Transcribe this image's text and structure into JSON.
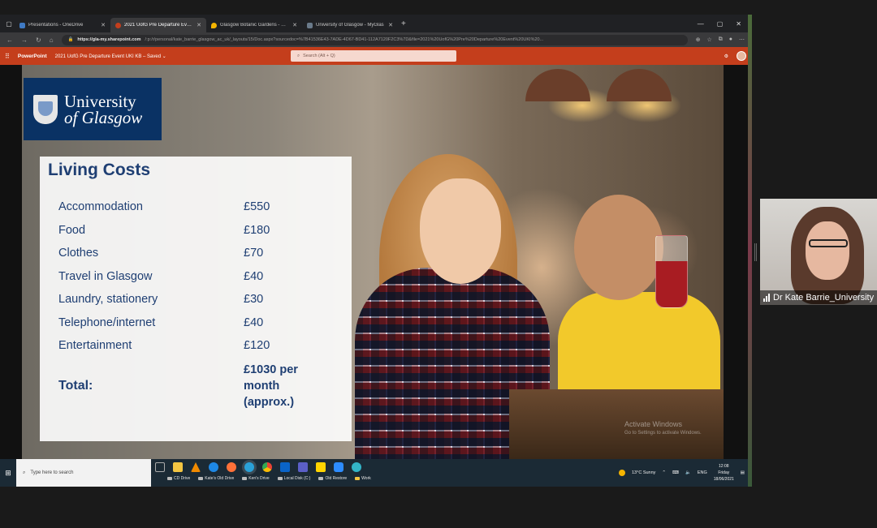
{
  "browser": {
    "tabs": [
      {
        "title": "Presentations - OneDrive",
        "color": "#3f7ac4",
        "active": false
      },
      {
        "title": "2021 UofG Pre Departure Event",
        "color": "#c43e1c",
        "active": true
      },
      {
        "title": "Glasgow Botanic Gardens - Goo",
        "color": "#f4b400",
        "active": false
      },
      {
        "title": "University of Glasgow - MyGlas",
        "color": "#6a7a8a",
        "active": false
      }
    ],
    "new_tab": "+",
    "url_host": "https://gla-my.sharepoint.com",
    "url_path": "/:p:/r/personal/kate_barrie_glasgow_ac_uk/_layouts/15/Doc.aspx?sourcedoc=%7B41536E43-7ADE-4D67-BD41-112A7120F2C3%7D&file=2021%20UofG%20Pre%20Departure%20Event%20UKI%20..."
  },
  "powerpoint": {
    "app_name": "PowerPoint",
    "doc_title": "2021 UofG Pre Departure Event UKI KB",
    "saved_status": "Saved",
    "search_placeholder": "Search (Alt + Q)"
  },
  "slide": {
    "logo_line1": "University",
    "logo_line2": "of Glasgow",
    "title": "Living Costs",
    "items": [
      {
        "label": "Accommodation",
        "amount": "£550"
      },
      {
        "label": "Food",
        "amount": "£180"
      },
      {
        "label": "Clothes",
        "amount": "£70"
      },
      {
        "label": "Travel in Glasgow",
        "amount": "£40"
      },
      {
        "label": "Laundry, stationery",
        "amount": "£30"
      },
      {
        "label": "Telephone/internet",
        "amount": "£40"
      },
      {
        "label": "Entertainment",
        "amount": "£120"
      }
    ],
    "total_label": "Total:",
    "total_line1": "£1030 per",
    "total_line2": "month",
    "total_line3": "(approx.)",
    "watermark_line1": "Activate Windows",
    "watermark_line2": "Go to Settings to activate Windows."
  },
  "taskbar": {
    "search_placeholder": "Type here to search",
    "drives": [
      "CD Drive",
      "Kate's Old Drive",
      "Ken's Drive",
      "Local Disk (C:)",
      "Old Restore",
      "Work"
    ],
    "weather": "13°C  Sunny",
    "lang": "ENG",
    "time": "12:08",
    "day": "Friday",
    "date": "18/06/2021"
  },
  "video": {
    "participant_name": "Dr Kate Barrie_University"
  }
}
